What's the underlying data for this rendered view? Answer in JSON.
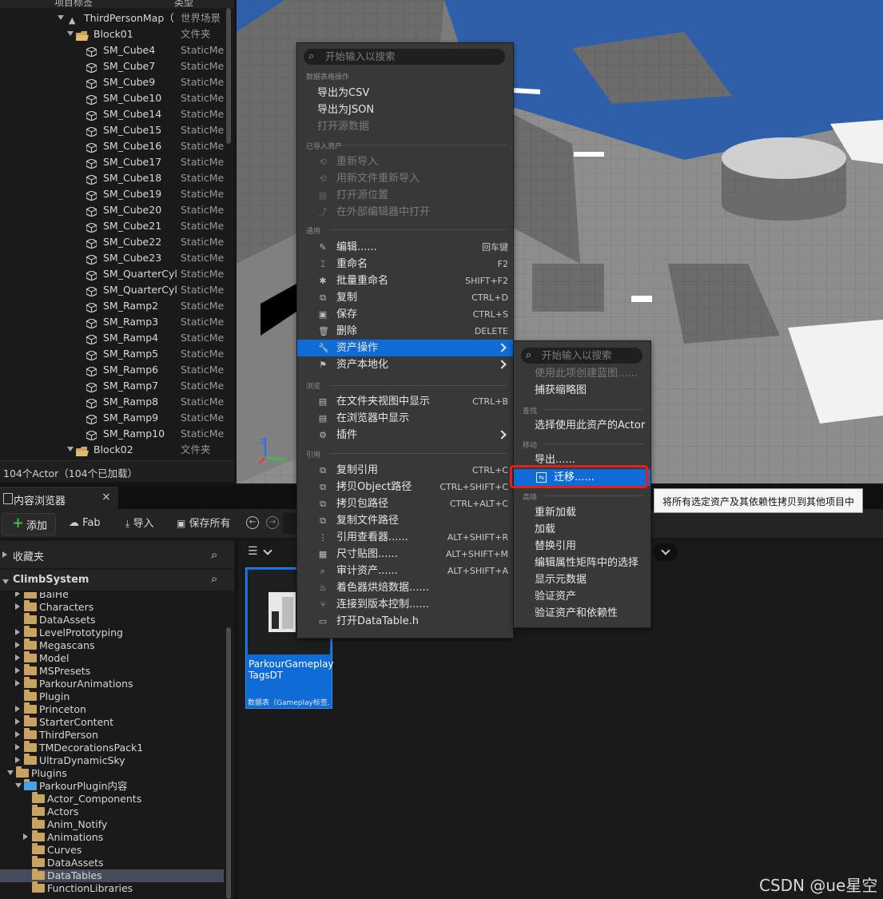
{
  "outliner": {
    "header_label": "项目标签",
    "header_type": "类型",
    "rows": [
      {
        "name": "ThirdPersonMap（",
        "type": "世界场景",
        "kind": "map"
      },
      {
        "name": "Block01",
        "type": "文件夹",
        "kind": "folder"
      },
      {
        "name": "SM_Cube4",
        "type": "StaticMesh",
        "kind": "mesh"
      },
      {
        "name": "SM_Cube7",
        "type": "StaticMesh",
        "kind": "mesh"
      },
      {
        "name": "SM_Cube9",
        "type": "StaticMesh",
        "kind": "mesh"
      },
      {
        "name": "SM_Cube10",
        "type": "StaticMesh",
        "kind": "mesh"
      },
      {
        "name": "SM_Cube14",
        "type": "StaticMesh",
        "kind": "mesh"
      },
      {
        "name": "SM_Cube15",
        "type": "StaticMesh",
        "kind": "mesh"
      },
      {
        "name": "SM_Cube16",
        "type": "StaticMesh",
        "kind": "mesh"
      },
      {
        "name": "SM_Cube17",
        "type": "StaticMesh",
        "kind": "mesh"
      },
      {
        "name": "SM_Cube18",
        "type": "StaticMesh",
        "kind": "mesh"
      },
      {
        "name": "SM_Cube19",
        "type": "StaticMesh",
        "kind": "mesh"
      },
      {
        "name": "SM_Cube20",
        "type": "StaticMesh",
        "kind": "mesh"
      },
      {
        "name": "SM_Cube21",
        "type": "StaticMesh",
        "kind": "mesh"
      },
      {
        "name": "SM_Cube22",
        "type": "StaticMesh",
        "kind": "mesh"
      },
      {
        "name": "SM_Cube23",
        "type": "StaticMesh",
        "kind": "mesh"
      },
      {
        "name": "SM_QuarterCyl",
        "type": "StaticMesh",
        "kind": "mesh"
      },
      {
        "name": "SM_QuarterCyl",
        "type": "StaticMesh",
        "kind": "mesh"
      },
      {
        "name": "SM_Ramp2",
        "type": "StaticMesh",
        "kind": "mesh"
      },
      {
        "name": "SM_Ramp3",
        "type": "StaticMesh",
        "kind": "mesh"
      },
      {
        "name": "SM_Ramp4",
        "type": "StaticMesh",
        "kind": "mesh"
      },
      {
        "name": "SM_Ramp5",
        "type": "StaticMesh",
        "kind": "mesh"
      },
      {
        "name": "SM_Ramp6",
        "type": "StaticMesh",
        "kind": "mesh"
      },
      {
        "name": "SM_Ramp7",
        "type": "StaticMesh",
        "kind": "mesh"
      },
      {
        "name": "SM_Ramp8",
        "type": "StaticMesh",
        "kind": "mesh"
      },
      {
        "name": "SM_Ramp9",
        "type": "StaticMesh",
        "kind": "mesh"
      },
      {
        "name": "SM_Ramp10",
        "type": "StaticMesh",
        "kind": "mesh"
      },
      {
        "name": "Block02",
        "type": "文件夹",
        "kind": "folder"
      }
    ],
    "footer": "104个Actor（104个已加载）"
  },
  "content_browser": {
    "tab_label": "内容浏览器",
    "toolbar": {
      "add": "添加",
      "fab": "Fab",
      "import": "导入",
      "save_all": "保存所有"
    },
    "favorites_label": "收藏夹",
    "project_label": "ClimbSystem",
    "folders": [
      {
        "name": "BaiHe",
        "indent": 1,
        "expand": "closed"
      },
      {
        "name": "Characters",
        "indent": 1,
        "expand": "closed"
      },
      {
        "name": "DataAssets",
        "indent": 1,
        "expand": "none"
      },
      {
        "name": "LevelPrototyping",
        "indent": 1,
        "expand": "closed"
      },
      {
        "name": "Megascans",
        "indent": 1,
        "expand": "closed"
      },
      {
        "name": "Model",
        "indent": 1,
        "expand": "closed"
      },
      {
        "name": "MSPresets",
        "indent": 1,
        "expand": "closed"
      },
      {
        "name": "ParkourAnimations",
        "indent": 1,
        "expand": "closed"
      },
      {
        "name": "Plugin",
        "indent": 1,
        "expand": "none"
      },
      {
        "name": "Princeton",
        "indent": 1,
        "expand": "closed"
      },
      {
        "name": "StarterContent",
        "indent": 1,
        "expand": "closed"
      },
      {
        "name": "ThirdPerson",
        "indent": 1,
        "expand": "closed"
      },
      {
        "name": "TMDecorationsPack1",
        "indent": 1,
        "expand": "closed"
      },
      {
        "name": "UltraDynamicSky",
        "indent": 1,
        "expand": "closed"
      },
      {
        "name": "Plugins",
        "indent": 0,
        "expand": "open"
      },
      {
        "name": "ParkourPlugin内容",
        "indent": 1,
        "expand": "open"
      },
      {
        "name": "Actor_Components",
        "indent": 2,
        "expand": "none"
      },
      {
        "name": "Actors",
        "indent": 2,
        "expand": "none"
      },
      {
        "name": "Anim_Notify",
        "indent": 2,
        "expand": "none"
      },
      {
        "name": "Animations",
        "indent": 2,
        "expand": "closed"
      },
      {
        "name": "Curves",
        "indent": 2,
        "expand": "none"
      },
      {
        "name": "DataAssets",
        "indent": 2,
        "expand": "none"
      },
      {
        "name": "DataTables",
        "indent": 2,
        "expand": "none",
        "selected": true
      },
      {
        "name": "FunctionLibraries",
        "indent": 2,
        "expand": "none"
      }
    ],
    "asset": {
      "name": "ParkourGameplayTagsDT",
      "name_line1": "ParkourGameplay",
      "name_line2": "TagsDT",
      "type": "数据表（Gameplay标签..."
    }
  },
  "context_menu": {
    "search_placeholder": "开始输入以搜索",
    "sections": {
      "datatable": "数据表格操作",
      "imported": "已导入资产",
      "common": "通用",
      "browse": "浏览",
      "references": "引用"
    },
    "datatable_items": [
      {
        "label": "导出为CSV",
        "disabled": false
      },
      {
        "label": "导出为JSON",
        "disabled": false
      },
      {
        "label": "打开源数据",
        "disabled": true
      }
    ],
    "imported_items": [
      {
        "label": "重新导入",
        "icon": "reimport-icon",
        "disabled": true
      },
      {
        "label": "用新文件重新导入",
        "icon": "reimport-file-icon",
        "disabled": true
      },
      {
        "label": "打开源位置",
        "icon": "open-location-icon",
        "disabled": true
      },
      {
        "label": "在外部编辑器中打开",
        "icon": "external-editor-icon",
        "disabled": true
      }
    ],
    "common_items": [
      {
        "label": "编辑......",
        "shortcut": "回车键",
        "icon": "edit-icon"
      },
      {
        "label": "重命名",
        "shortcut": "F2",
        "icon": "rename-icon"
      },
      {
        "label": "批量重命名",
        "shortcut": "SHIFT+F2",
        "icon": "batch-rename-icon"
      },
      {
        "label": "复制",
        "shortcut": "CTRL+D",
        "icon": "duplicate-icon"
      },
      {
        "label": "保存",
        "shortcut": "CTRL+S",
        "icon": "save-icon"
      },
      {
        "label": "删除",
        "shortcut": "DELETE",
        "icon": "delete-icon"
      },
      {
        "label": "资产操作",
        "shortcut": "",
        "icon": "wrench-icon",
        "submenu": true,
        "selected": true
      },
      {
        "label": "资产本地化",
        "shortcut": "",
        "icon": "flag-icon",
        "submenu": true
      }
    ],
    "browse_items": [
      {
        "label": "在文件夹视图中显示",
        "shortcut": "CTRL+B",
        "icon": "folder-view-icon"
      },
      {
        "label": "在浏览器中显示",
        "shortcut": "",
        "icon": "browser-show-icon"
      },
      {
        "label": "插件",
        "shortcut": "",
        "icon": "plugin-icon",
        "submenu": true
      }
    ],
    "reference_items": [
      {
        "label": "复制引用",
        "shortcut": "CTRL+C",
        "icon": "copy-ref-icon"
      },
      {
        "label": "拷贝Object路径",
        "shortcut": "CTRL+SHIFT+C",
        "icon": "copy-object-path-icon"
      },
      {
        "label": "拷贝包路径",
        "shortcut": "CTRL+ALT+C",
        "icon": "copy-package-path-icon"
      },
      {
        "label": "复制文件路径",
        "shortcut": "",
        "icon": "copy-file-path-icon"
      },
      {
        "label": "引用查看器......",
        "shortcut": "ALT+SHIFT+R",
        "icon": "reference-viewer-icon"
      },
      {
        "label": "尺寸贴图......",
        "shortcut": "ALT+SHIFT+M",
        "icon": "size-map-icon"
      },
      {
        "label": "审计资产......",
        "shortcut": "ALT+SHIFT+A",
        "icon": "audit-icon"
      },
      {
        "label": "着色器烘焙数据......",
        "shortcut": "",
        "icon": "shader-icon"
      },
      {
        "label": "连接到版本控制......",
        "shortcut": "",
        "icon": "source-control-icon"
      },
      {
        "label": "打开DataTable.h",
        "shortcut": "",
        "icon": "header-file-icon"
      }
    ]
  },
  "submenu": {
    "search_placeholder": "开始输入以搜索",
    "items_top": [
      {
        "label": "使用此项创建蓝图......",
        "disabled": true
      },
      {
        "label": "捕获缩略图",
        "disabled": false
      }
    ],
    "find_header": "查找",
    "find_items": [
      {
        "label": "选择使用此资产的Actor"
      }
    ],
    "move_header": "移动",
    "move_items": [
      {
        "label": "导出......"
      },
      {
        "label": "迁移......",
        "selected": true
      }
    ],
    "advanced_header": "高级",
    "advanced_items": [
      {
        "label": "重新加载"
      },
      {
        "label": "加载"
      },
      {
        "label": "替换引用"
      },
      {
        "label": "编辑属性矩阵中的选择"
      },
      {
        "label": "显示元数据"
      },
      {
        "label": "验证资产"
      },
      {
        "label": "验证资产和依赖性"
      }
    ],
    "tooltip": "将所有选定资产及其依赖性拷贝到其他项目中"
  },
  "watermark": "CSDN @ue星空",
  "colors": {
    "accent": "#0f6cd6",
    "highlight_box": "#e0201f",
    "folder": "#c9a361",
    "add_icon": "#3fbf3f",
    "blue_floor": "#2f5fa8"
  }
}
